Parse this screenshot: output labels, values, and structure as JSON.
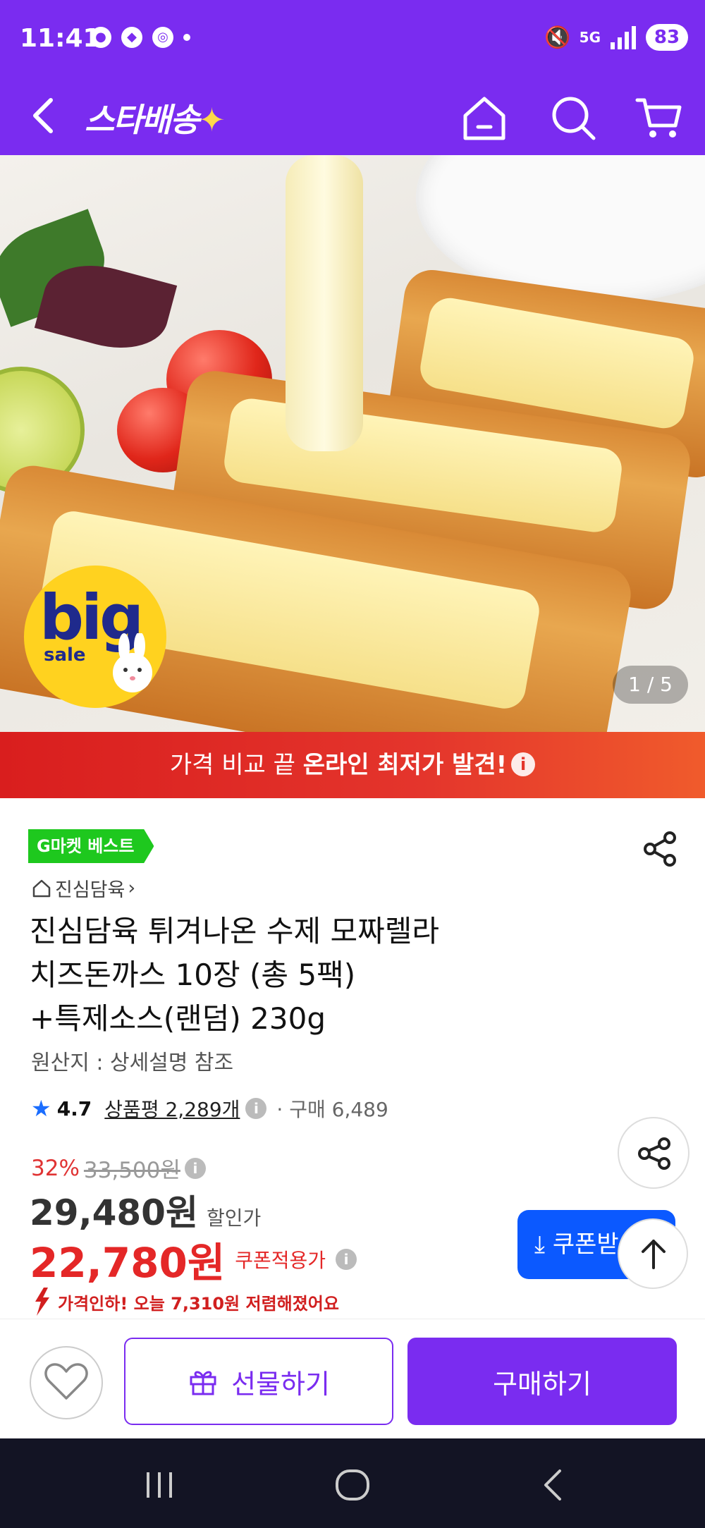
{
  "status_bar": {
    "time": "11:41",
    "network": "5G",
    "battery": "83"
  },
  "header": {
    "brand": "스타배송",
    "brand_star": "✦"
  },
  "hero": {
    "badge_big": "big",
    "badge_sale": "sale",
    "pager": "1 / 5"
  },
  "banner": {
    "prefix": "가격 비교 끝 ",
    "highlight": "온라인 최저가 발견!",
    "info_icon": "i"
  },
  "product": {
    "badge": "G마켓 베스트",
    "store": "진심담육",
    "title_line1": "진심담육 튀겨나온 수제 모짜렐라",
    "title_line2": "치즈돈까스 10장 (총 5팩)",
    "title_line3": "+특제소스(랜덤) 230g",
    "origin": "원산지 : 상세설명 참조",
    "rating": "4.7",
    "reviews": "상품평 2,289개",
    "purchases": "구매 6,489"
  },
  "pricing": {
    "discount_pct": "32%",
    "original_price": "33,500원",
    "sale_price": "29,480원",
    "sale_label": "할인가",
    "coupon_price": "22,780원",
    "coupon_label": "쿠폰적용가",
    "coupon_button": "쿠폰받",
    "price_drop_msg": "가격인하! 오늘 7,310원 저렴해졌어요"
  },
  "bottom": {
    "gift": "선물하기",
    "buy": "구매하기"
  },
  "colors": {
    "brand_purple": "#7a2cf0",
    "banner_red": "#e4352c",
    "coupon_blue": "#0b59ff",
    "price_red": "#e42727",
    "best_green": "#1ec81e"
  },
  "icons": {
    "back": "chevron-left-icon",
    "home": "home-icon",
    "search": "search-icon",
    "cart": "cart-icon",
    "share": "share-icon",
    "wish": "heart-icon",
    "gift": "gift-icon",
    "top": "arrow-up-icon"
  }
}
